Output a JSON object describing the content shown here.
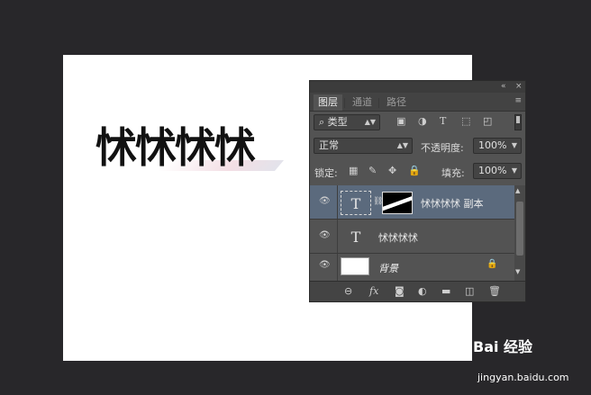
{
  "canvas": {
    "text": "怵怵怵怵"
  },
  "panel": {
    "collapse_icon": "«",
    "close_icon": "×",
    "tabs": [
      {
        "label": "图层",
        "active": true
      },
      {
        "label": "通道",
        "active": false
      },
      {
        "label": "路径",
        "active": false
      }
    ],
    "menu_icon": "≡",
    "filter": {
      "search_icon": "⌕",
      "kind_label": "类型",
      "icons": [
        "image-filter-icon",
        "adjustment-filter-icon",
        "text-filter-icon",
        "shape-filter-icon",
        "smart-object-filter-icon"
      ]
    },
    "blend_mode": "正常",
    "opacity_label": "不透明度:",
    "opacity_value": "100%",
    "lock_label": "锁定:",
    "fill_label": "填充:",
    "fill_value": "100%",
    "layers": [
      {
        "name": "怵怵怵怵 副本",
        "type": "text",
        "selected": true,
        "has_mask": true,
        "thumb_glyph": "T"
      },
      {
        "name": "怵怵怵怵",
        "type": "text",
        "selected": false,
        "has_mask": false,
        "thumb_glyph": "T"
      },
      {
        "name": "背景",
        "type": "background",
        "selected": false,
        "locked": true
      }
    ],
    "footer_icons": [
      "link-icon",
      "fx-icon",
      "mask-icon",
      "adjustment-icon",
      "group-icon",
      "new-layer-icon",
      "delete-icon"
    ],
    "fx_label": "fx"
  },
  "watermark": {
    "brand": "Bai 经验",
    "url": "jingyan.baidu.com"
  }
}
